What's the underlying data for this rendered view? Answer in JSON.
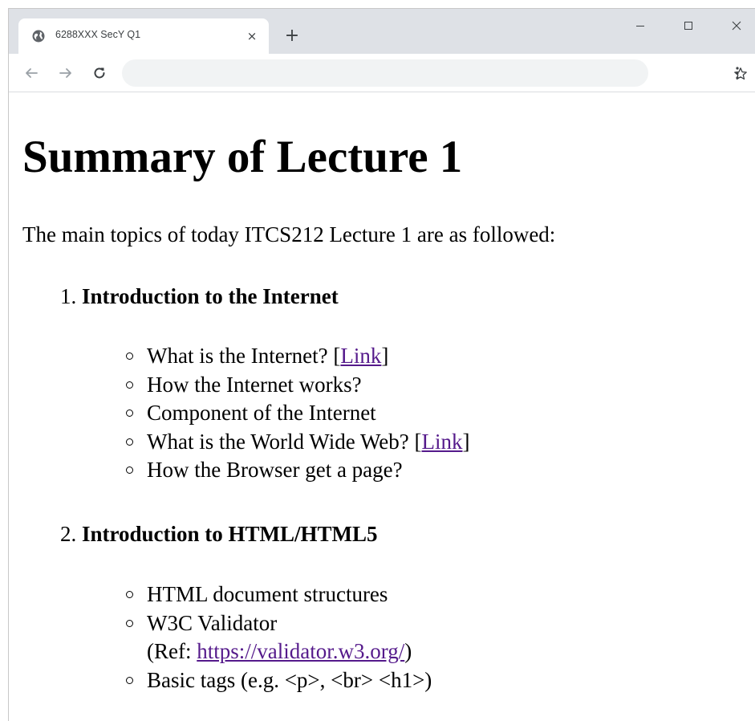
{
  "browser": {
    "tab_title": "6288XXX SecY Q1",
    "tab_close_icon": "×",
    "new_tab_icon": "+",
    "address": ""
  },
  "page": {
    "title": "Summary of Lecture 1",
    "intro": "The main topics of today ITCS212 Lecture 1 are as followed:",
    "topics": [
      {
        "number": "1.",
        "title": "Introduction to the Internet",
        "items": [
          {
            "text": "What is the Internet? ",
            "open": "[",
            "link": "Link",
            "close": "]"
          },
          {
            "text": "How the Internet works?"
          },
          {
            "text": "Component of the Internet"
          },
          {
            "text": "What is the World Wide Web? ",
            "open": "[",
            "link": "Link",
            "close": "]"
          },
          {
            "text": "How the Browser get a page?"
          }
        ]
      },
      {
        "number": "2.",
        "title": "Introduction to HTML/HTML5",
        "items": [
          {
            "text": "HTML document structures"
          },
          {
            "text": "W3C Validator",
            "ref_prefix": "(Ref: ",
            "ref_link": "https://validator.w3.org/",
            "ref_suffix": ")"
          },
          {
            "text": "Basic tags (e.g. <p>, <br> <h1>)"
          }
        ]
      }
    ]
  },
  "colors": {
    "tabstrip": "#dee1e6",
    "link_visited": "#551a8b",
    "omnibox": "#f1f3f4"
  },
  "icons": {
    "favicon": "globe-icon",
    "back": "back-arrow-icon",
    "forward": "forward-arrow-icon",
    "reload": "reload-icon",
    "bookmark": "star-icon",
    "menu": "kebab-menu-icon",
    "minimize": "minimize-icon",
    "maximize": "maximize-icon",
    "close": "close-icon"
  }
}
